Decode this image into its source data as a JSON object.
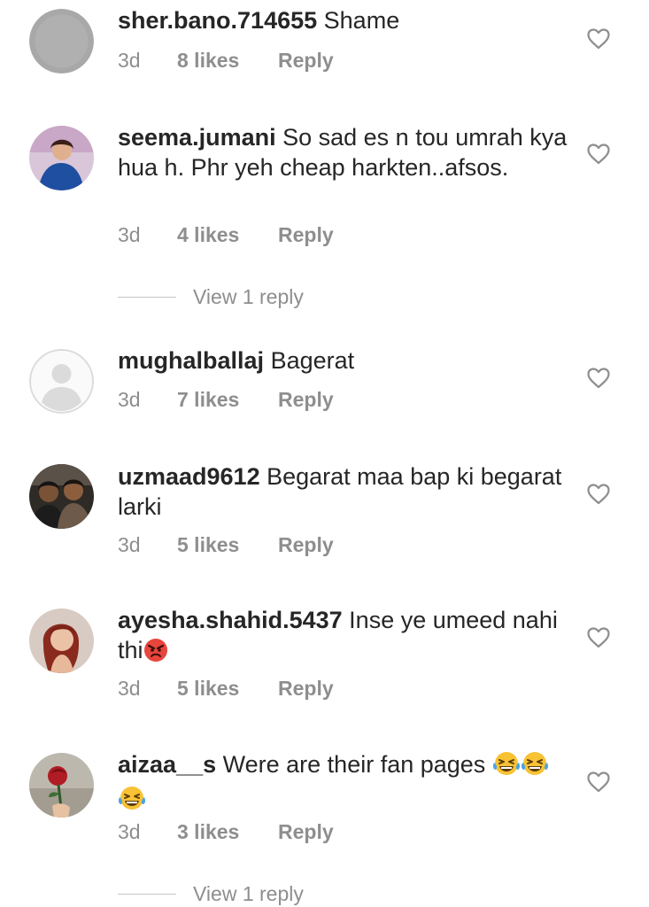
{
  "comments": [
    {
      "username": "sher.bano.714655",
      "text": "Shame",
      "time": "3d",
      "likes": "8 likes",
      "reply": "Reply",
      "avatar": "gray-blank-avatar"
    },
    {
      "username": "seema.jumani",
      "text": "So sad es n tou umrah kya hua h. Phr yeh cheap harkten..afsos.",
      "time": "3d",
      "likes": "4 likes",
      "reply": "Reply",
      "avatar": "woman-blue-dress-avatar"
    },
    {
      "username": "mughalballaj",
      "text": "Bagerat",
      "time": "3d",
      "likes": "7 likes",
      "reply": "Reply",
      "avatar": "default-user-avatar"
    },
    {
      "username": "uzmaad9612",
      "text": "Begarat maa bap ki begarat larki",
      "time": "3d",
      "likes": "5 likes",
      "reply": "Reply",
      "avatar": "two-men-avatar"
    },
    {
      "username": "ayesha.shahid.5437",
      "text": "Inse ye umeed nahi thi",
      "emoji": "angry-face-emoji",
      "time": "3d",
      "likes": "5 likes",
      "reply": "Reply",
      "avatar": "woman-portrait-avatar"
    },
    {
      "username": "aizaa__s",
      "text": "Were are their fan pages",
      "emoji": "laughing-tears-emoji",
      "time": "3d",
      "likes": "3 likes",
      "reply": "Reply",
      "avatar": "red-rose-avatar"
    }
  ],
  "view_replies": [
    "View 1 reply",
    "View 1 reply"
  ],
  "colors": {
    "text": "#262626",
    "muted": "#8e8e8e",
    "line": "#c7c7c7",
    "heart": "#8e8e8e"
  },
  "icons": {
    "like": "heart-outline-icon"
  }
}
